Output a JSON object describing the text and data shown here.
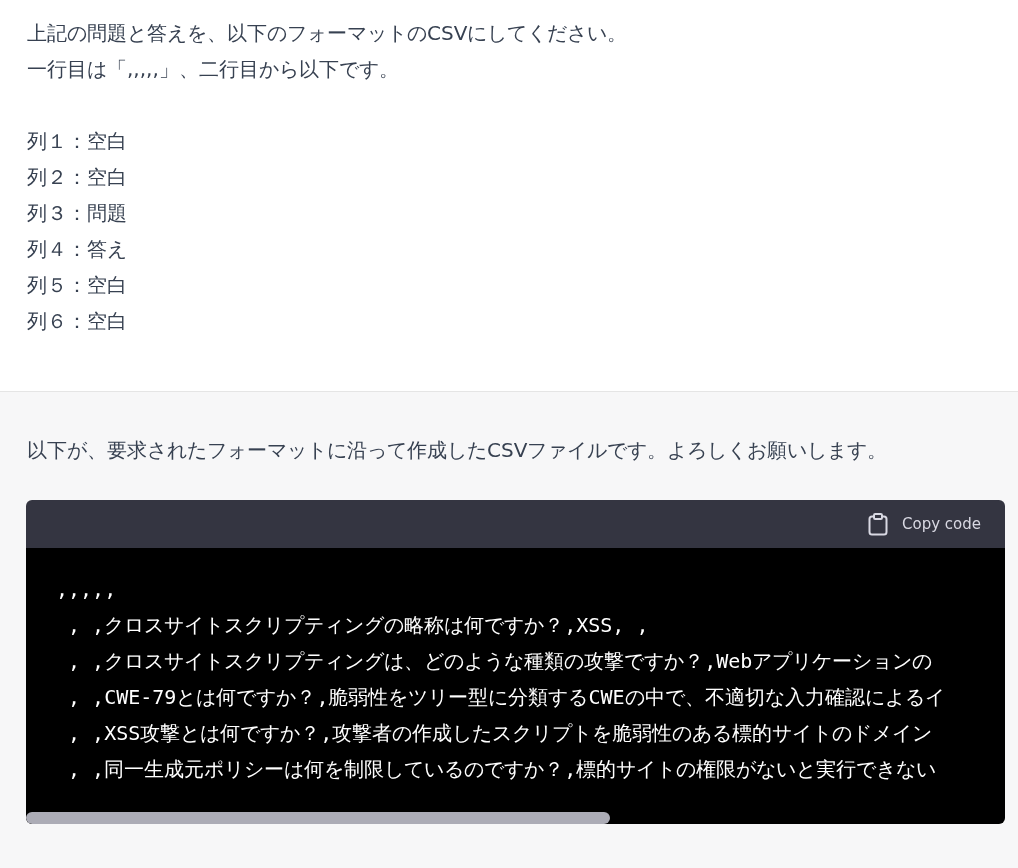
{
  "user_message": {
    "lines": [
      "上記の問題と答えを、以下のフォーマットのCSVにしてください。",
      "一行目は「,,,,,」、二行目から以下です。"
    ],
    "column_specs": [
      "列１：空白",
      "列２：空白",
      "列３：問題",
      "列４：答え",
      "列５：空白",
      "列６：空白"
    ]
  },
  "assistant_message": {
    "text": "以下が、要求されたフォーマットに沿って作成したCSVファイルです。よろしくお願いします。",
    "code_block": {
      "copy_label": "Copy code",
      "lines": [
        ",,,,,",
        " , ,クロスサイトスクリプティングの略称は何ですか？,XSS, ,",
        " , ,クロスサイトスクリプティングは、どのような種類の攻撃ですか？,Webアプリケーションの",
        " , ,CWE-79とは何ですか？,脆弱性をツリー型に分類するCWEの中で、不適切な入力確認によるイ",
        " , ,XSS攻撃とは何ですか？,攻撃者の作成したスクリプトを脆弱性のある標的サイトのドメイン",
        " , ,同一生成元ポリシーは何を制限しているのですか？,標的サイトの権限がないと実行できない"
      ]
    }
  }
}
